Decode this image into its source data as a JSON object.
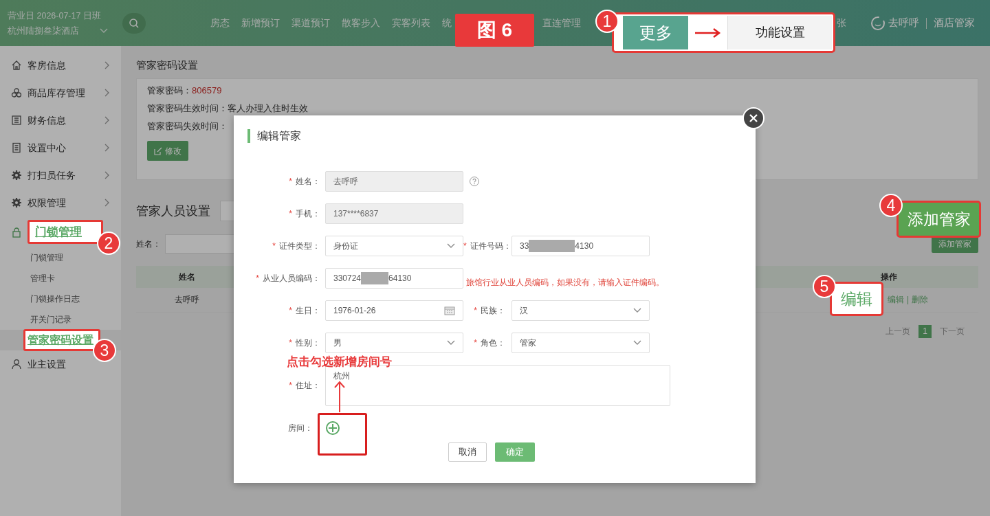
{
  "header": {
    "business_day": "营业日 2026-07-17 日班",
    "hotel": "杭州陆捌叁柒酒店",
    "nav_groups": [
      [
        "房态",
        "新增预订",
        "渠道预订",
        "散客步入",
        "宾客列表",
        "统"
      ],
      [
        "直连管理"
      ],
      [
        "张"
      ]
    ],
    "logo": "去呼呼",
    "product": "酒店管家"
  },
  "sidebar": {
    "items": [
      {
        "label": "客房信息",
        "kind": "group",
        "expanded": false
      },
      {
        "label": "商品库存管理",
        "kind": "group",
        "expanded": false
      },
      {
        "label": "财务信息",
        "kind": "group",
        "expanded": false
      },
      {
        "label": "设置中心",
        "kind": "group",
        "expanded": false
      },
      {
        "label": "打扫员任务",
        "kind": "group",
        "expanded": false
      },
      {
        "label": "权限管理",
        "kind": "group",
        "expanded": false
      },
      {
        "label": "门锁管理",
        "kind": "group",
        "expanded": true,
        "callout": "2",
        "children": [
          {
            "label": "门锁管理",
            "selected": false
          },
          {
            "label": "管理卡",
            "selected": false
          },
          {
            "label": "门锁操作日志",
            "selected": false
          },
          {
            "label": "开关门记录",
            "selected": false
          },
          {
            "label": "管家密码设置",
            "selected": true,
            "callout": "3"
          }
        ]
      },
      {
        "label": "业主设置",
        "kind": "link",
        "expanded": false
      }
    ]
  },
  "main": {
    "page_title": "管家密码设置",
    "password_card": {
      "rows": [
        {
          "label": "管家密码：",
          "value": "806579",
          "kind": "highlight"
        },
        {
          "label": "管家密码生效时间：",
          "value": "客人办理入住时生效",
          "kind": "plain"
        },
        {
          "label": "管家密码失效时间：",
          "kind": "plain"
        }
      ],
      "edit_button": "修改"
    },
    "staff_section": {
      "title": "管家人员设置",
      "search_label": "姓名：",
      "add_button": "添加管家",
      "table": {
        "columns": [
          "姓名",
          "操作"
        ],
        "rows": [
          {
            "name": "去呼呼",
            "actions": [
              "编辑",
              "删除"
            ],
            "separator": "|"
          }
        ]
      },
      "pagination": {
        "prev": "上一页",
        "pages": [
          {
            "label": "1",
            "selected": true
          }
        ],
        "next": "下一页"
      }
    }
  },
  "modal": {
    "title": "编辑管家",
    "rows": [
      [
        {
          "mark": "*",
          "label": "姓名：",
          "kind": "text",
          "value": "去呼呼",
          "disabled": true,
          "help": true
        }
      ],
      [
        {
          "mark": "*",
          "label": "手机：",
          "kind": "text",
          "value": "137****6837",
          "disabled": true
        }
      ],
      [
        {
          "mark": "*",
          "label": "证件类型：",
          "kind": "select",
          "value": "身份证",
          "disabled": false
        },
        {
          "mark": "*",
          "label": "证件号码：",
          "kind": "text",
          "value": "33",
          "value_after": "4130",
          "redacted": true,
          "disabled": false
        }
      ],
      [
        {
          "mark": "*",
          "label": "从业人员编码：",
          "kind": "text",
          "value": "330724",
          "value_after": "64130",
          "redacted": true,
          "disabled": false,
          "hint": "旅馆行业从业人员编码，如果没有，请输入证件编码。"
        }
      ],
      [
        {
          "mark": "*",
          "label": "生日：",
          "kind": "date",
          "value": "1976-01-26",
          "disabled": false
        },
        {
          "mark": "*",
          "label": "民族：",
          "kind": "select",
          "value": "汉",
          "disabled": false
        }
      ],
      [
        {
          "mark": "*",
          "label": "性别：",
          "kind": "select",
          "value": "男",
          "disabled": false
        },
        {
          "mark": "*",
          "label": "角色：",
          "kind": "select",
          "value": "管家",
          "disabled": false
        }
      ],
      [
        {
          "mark": "*",
          "label": "住址：",
          "kind": "textarea",
          "value": "杭州",
          "disabled": false
        }
      ],
      [
        {
          "label": "房间：",
          "kind": "add"
        }
      ]
    ],
    "buttons": [
      {
        "label": "取消",
        "kind": "secondary"
      },
      {
        "label": "确定",
        "kind": "primary"
      }
    ]
  },
  "annotations": {
    "figure_label": "图 6",
    "room_hint": "点击勾选新增房间号",
    "callouts": [
      {
        "number": "1",
        "kind": "menu_path",
        "from": "更多",
        "to": "功能设置"
      },
      {
        "number": "4",
        "kind": "green",
        "text": "添加管家"
      },
      {
        "number": "5",
        "kind": "white",
        "text": "编辑"
      }
    ]
  }
}
